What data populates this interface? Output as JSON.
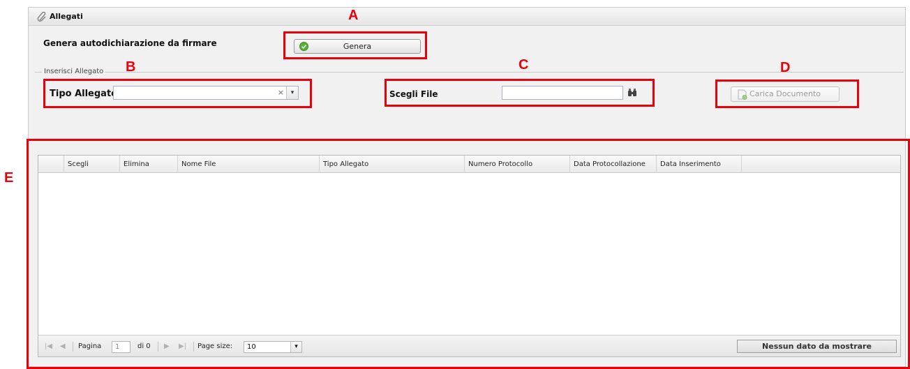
{
  "panel": {
    "title": "Allegati",
    "icon": "paperclip-icon"
  },
  "genera_section": {
    "label": "Genera autodichiarazione da firmare",
    "button_label": "Genera",
    "button_icon": "check-circle-icon"
  },
  "fieldset": {
    "legend": "Inserisci Allegato"
  },
  "tipo_allegato": {
    "label": "Tipo Allegato",
    "value": "",
    "clear_glyph": "×",
    "trigger_glyph": "▾"
  },
  "scegli_file": {
    "label": "Scegli File",
    "value": "",
    "button_icon": "binoculars-icon"
  },
  "carica_button": {
    "label": "Carica Documento",
    "enabled": false,
    "icon": "document-add-icon"
  },
  "grid": {
    "columns": [
      "Scegli",
      "Elimina",
      "Nome File",
      "Tipo Allegato",
      "Numero Protocollo",
      "Data Protocollazione",
      "Data Inserimento"
    ],
    "rows": []
  },
  "paging": {
    "page_label": "Pagina",
    "page_value": "1",
    "of_label": "di 0",
    "page_size_label": "Page size:",
    "page_size_value": "10",
    "status": "Nessun dato da mostrare"
  },
  "annotations": [
    "A",
    "B",
    "C",
    "D",
    "E"
  ],
  "colors": {
    "annotation": "#e8000b",
    "panel_bg": "#f1f1f1",
    "header_bg": "#e4e4e4"
  }
}
